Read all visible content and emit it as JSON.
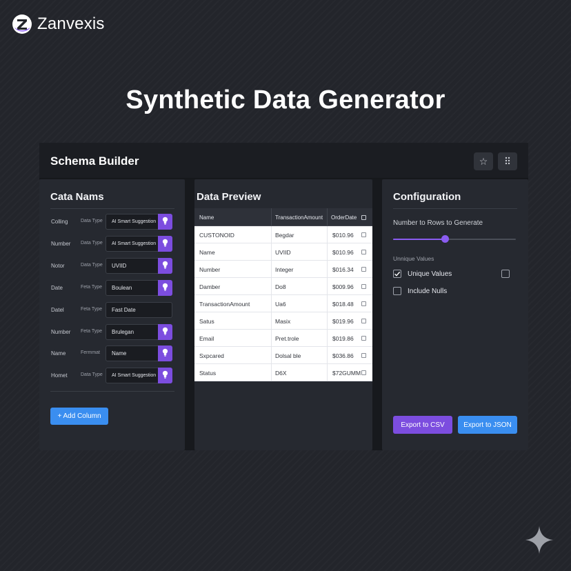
{
  "brand": {
    "name": "Zanvexis"
  },
  "hero": {
    "title": "Synthetic Data Generator"
  },
  "app": {
    "title": "Schema Builder",
    "star_icon": "star-icon",
    "grid_icon": "grid-dots-icon"
  },
  "schema": {
    "title": "Cata Nams",
    "rows": [
      {
        "name": "Colling",
        "type": "Data Type",
        "select": "AI Smart Suggestion",
        "ai": true,
        "small": true
      },
      {
        "name": "Number",
        "type": "Data Type",
        "select": "AI Smart Suggestion",
        "ai": true,
        "small": true
      },
      {
        "name": "Notor",
        "type": "Data Type",
        "select": "UVIID",
        "ai": true,
        "small": false
      },
      {
        "name": "Date",
        "type": "Feta Type",
        "select": "Boulean",
        "ai": true,
        "small": false
      },
      {
        "name": "Datel",
        "type": "Feta Type",
        "select": "Fast Date",
        "ai": false,
        "small": false
      },
      {
        "name": "Number",
        "type": "Feta Type",
        "select": "Brulegan",
        "ai": true,
        "small": false
      },
      {
        "name": "Name",
        "type": "Fermmat",
        "select": "Name",
        "ai": true,
        "small": false
      },
      {
        "name": "Homet",
        "type": "Data Type",
        "select": "AI Smart Suggestion",
        "ai": true,
        "small": true
      }
    ],
    "add_label": "+ Add Column"
  },
  "preview": {
    "title": "Data Preview",
    "columns": [
      "Name",
      "TransactionAmount",
      "OrderDate"
    ],
    "rows": [
      [
        "CUSTONOID",
        "Begdar",
        "$010.96"
      ],
      [
        "Name",
        "UVIID",
        "$010.96"
      ],
      [
        "Number",
        "Integer",
        "$016.34"
      ],
      [
        "Damber",
        "Do8",
        "$009.96"
      ],
      [
        "TransactionAmount",
        "Ua6",
        "$018.48"
      ],
      [
        "Satus",
        "Masix",
        "$019.96"
      ],
      [
        "Email",
        "Pret.trole",
        "$019.86"
      ],
      [
        "Sxpcared",
        "Dolsal ble",
        "$036.86"
      ],
      [
        "Status",
        "D6X",
        "$72GUMM"
      ]
    ]
  },
  "config": {
    "title": "Configuration",
    "rows_label": "Number to Rows to Generate",
    "slider_value": 0.42,
    "unique_sub": "Unnique Values",
    "unique_label": "Unique Values",
    "unique_checked": true,
    "nulls_label": "Include Nulls",
    "nulls_checked": false,
    "export_csv": "Export to CSV",
    "export_json": "Export to JSON"
  },
  "colors": {
    "accent_purple": "#7c4ddf",
    "accent_blue": "#3a8ef0"
  }
}
